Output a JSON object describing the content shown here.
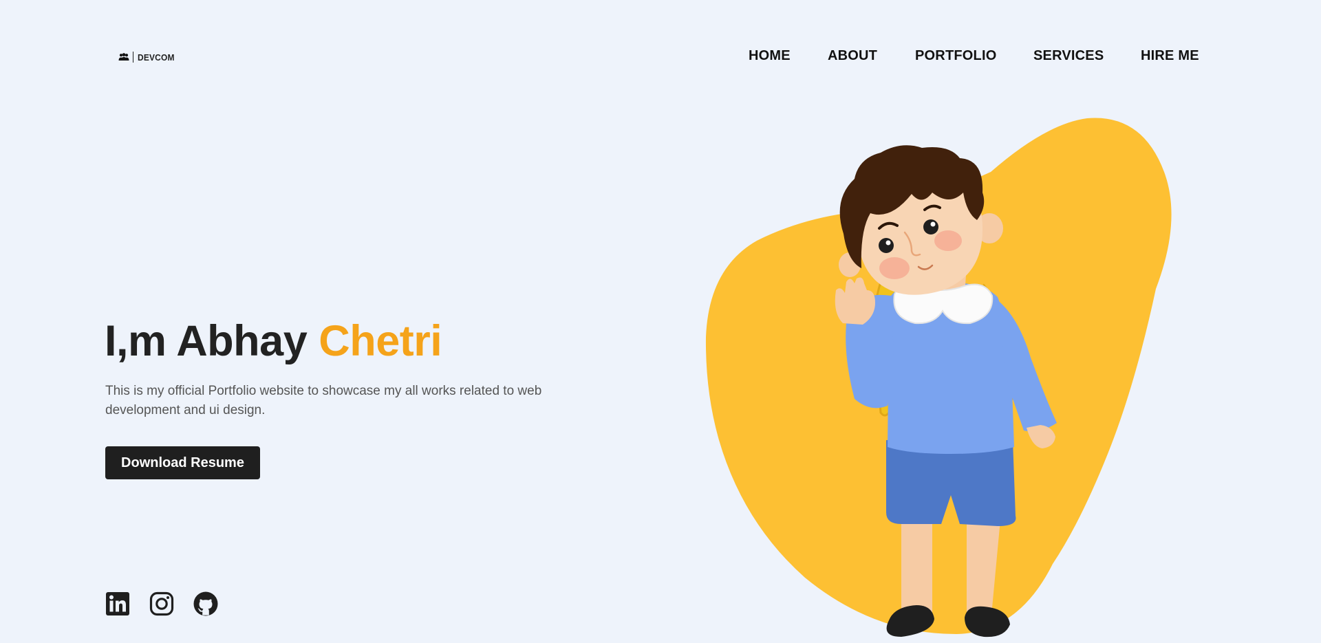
{
  "header": {
    "logo_text": "DEVCOM",
    "logo_icon": "users-icon"
  },
  "nav": {
    "items": [
      {
        "label": "HOME"
      },
      {
        "label": "ABOUT"
      },
      {
        "label": "PORTFOLIO"
      },
      {
        "label": "SERVICES"
      },
      {
        "label": "HIRE ME"
      }
    ]
  },
  "hero": {
    "title_main": "I,m Abhay",
    "title_accent": "Chetri",
    "description": "This is my official Portfolio website to showcase my all works related to web development and ui design.",
    "resume_button": "Download Resume",
    "accent_color": "#f5a31a"
  },
  "socials": [
    {
      "name": "linkedin-icon"
    },
    {
      "name": "instagram-icon"
    },
    {
      "name": "github-icon"
    }
  ],
  "colors": {
    "background": "#eef3fb",
    "blob": "#fdc033",
    "button": "#1f1f1f"
  }
}
